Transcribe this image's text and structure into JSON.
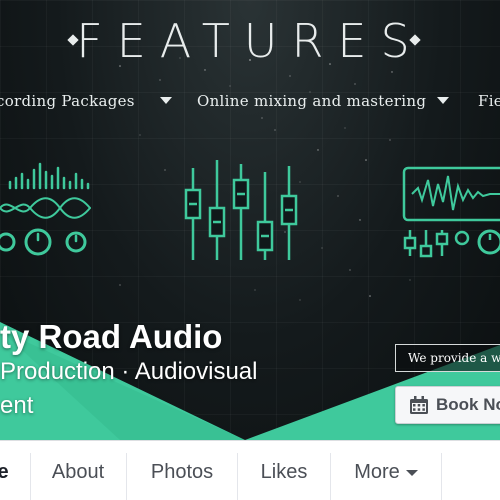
{
  "cover": {
    "heading": "FEATURES",
    "nav": [
      {
        "label": "cording Packages"
      },
      {
        "label": "Online mixing and mastering"
      },
      {
        "label": "Fie"
      }
    ]
  },
  "page": {
    "name": "ty Road Audio",
    "category_line1": "Production · Audiovisual",
    "category_line2": "ent"
  },
  "actions": {
    "promo_text": "We provide a wid",
    "book_label": "Book No"
  },
  "tabs": [
    {
      "label": "e"
    },
    {
      "label": "About"
    },
    {
      "label": "Photos"
    },
    {
      "label": "Likes"
    },
    {
      "label": "More"
    }
  ],
  "colors": {
    "accent": "#3fc99c",
    "cover_bg": "#141a1c"
  }
}
